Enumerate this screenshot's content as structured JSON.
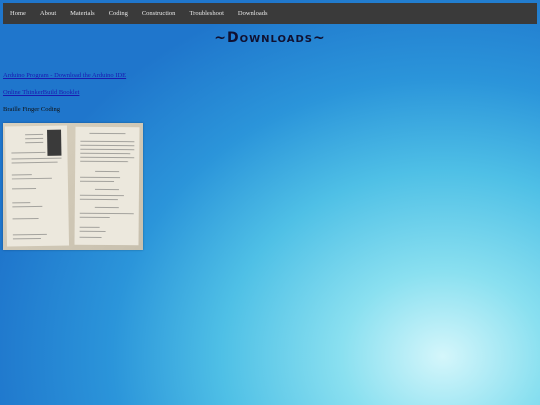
{
  "nav": {
    "items": [
      "Home",
      "About",
      "Materials",
      "Coding",
      "Construction",
      "Troubleshoot",
      "Downloads"
    ]
  },
  "page": {
    "title": "~Downloads~",
    "link_arduino": "Arduino Program - Download the Arduino IDE",
    "link_booklet": "Online ThinkerBuild Booklet",
    "braille_label": "Braille Finger Coding"
  }
}
